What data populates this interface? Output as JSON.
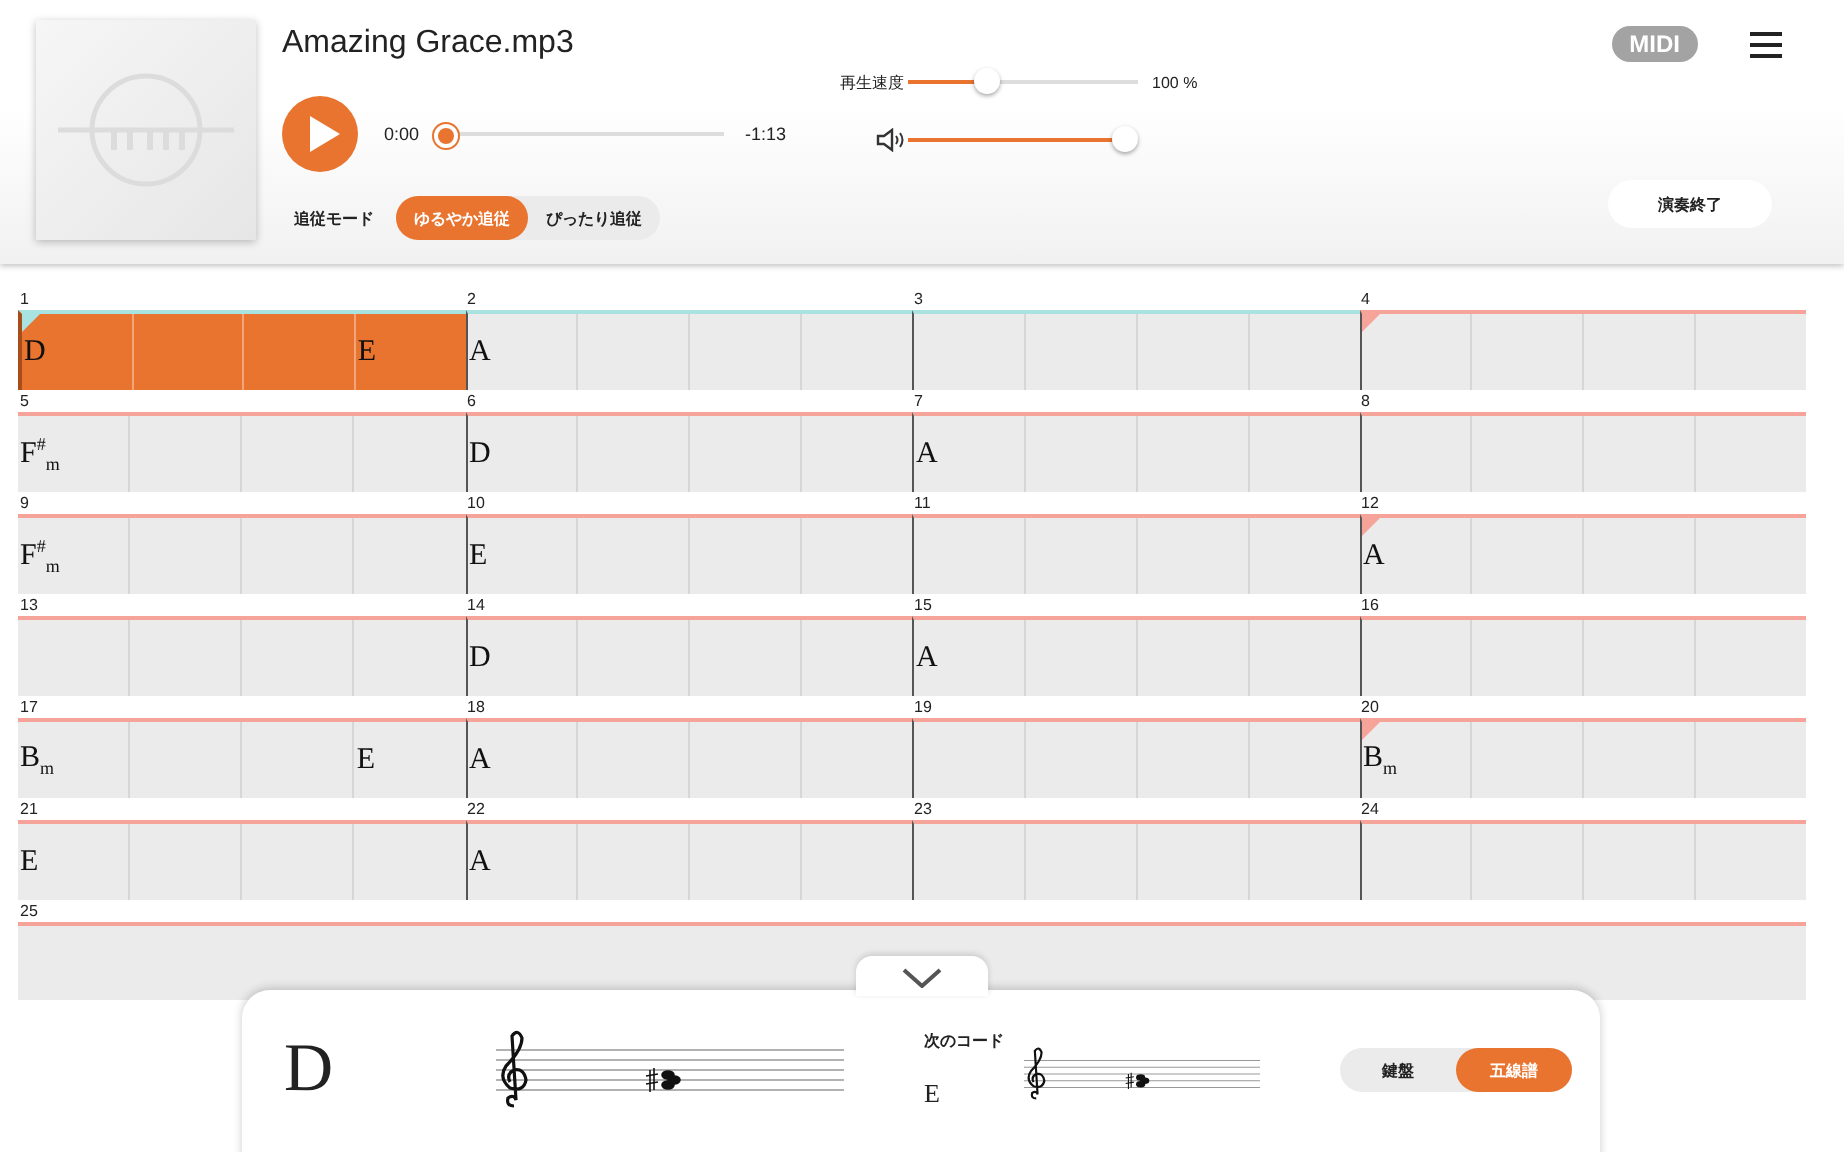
{
  "player": {
    "title": "Amazing Grace.mp3",
    "playing": false,
    "elapsed": "0:00",
    "remaining": "-1:13",
    "position": {
      "level": 0.0
    },
    "speed": {
      "label": "再生速度",
      "level": 0.35,
      "reading": "100 %"
    },
    "volume": {
      "level": 0.95
    }
  },
  "midi_badge": "MIDI",
  "follow_mode": {
    "label": "追従モード",
    "options": [
      {
        "label": "ゆるやか追従",
        "selected": true
      },
      {
        "label": "ぴったり追従",
        "selected": false
      }
    ]
  },
  "end_button": "演奏終了",
  "measures": [
    {
      "kind": "bar",
      "number": "1",
      "highlighted": true,
      "marker": true,
      "played": true,
      "beat_1": "D",
      "beat_4": "E"
    },
    {
      "kind": "bar",
      "number": "2",
      "highlighted": true,
      "marker": false,
      "played": false,
      "beat_1": "A"
    },
    {
      "kind": "bar",
      "number": "3",
      "highlighted": true,
      "marker": false,
      "played": false
    },
    {
      "kind": "bar",
      "number": "4",
      "highlighted": false,
      "marker": true,
      "played": false
    },
    {
      "kind": "bar",
      "number": "5",
      "highlighted": false,
      "marker": false,
      "played": false,
      "beat_1": "F$^{#}$$_{m}$"
    },
    {
      "kind": "bar",
      "number": "6",
      "highlighted": false,
      "marker": false,
      "played": false,
      "beat_1": "D"
    },
    {
      "kind": "bar",
      "number": "7",
      "highlighted": false,
      "marker": false,
      "played": false,
      "beat_1": "A"
    },
    {
      "kind": "bar",
      "number": "8",
      "highlighted": false,
      "marker": false,
      "played": false
    },
    {
      "kind": "bar",
      "number": "9",
      "highlighted": false,
      "marker": false,
      "played": false,
      "beat_1": "F$^{#}$$_{m}$"
    },
    {
      "kind": "bar",
      "number": "10",
      "highlighted": false,
      "marker": false,
      "played": false,
      "beat_1": "E"
    },
    {
      "kind": "bar",
      "number": "11",
      "highlighted": false,
      "marker": false,
      "played": false
    },
    {
      "kind": "bar",
      "number": "12",
      "highlighted": false,
      "marker": true,
      "played": false,
      "beat_1": "A"
    },
    {
      "kind": "bar",
      "number": "13",
      "highlighted": false,
      "marker": false,
      "played": false
    },
    {
      "kind": "bar",
      "number": "14",
      "highlighted": false,
      "marker": false,
      "played": false,
      "beat_1": "D"
    },
    {
      "kind": "bar",
      "number": "15",
      "highlighted": false,
      "marker": false,
      "played": false,
      "beat_1": "A"
    },
    {
      "kind": "bar",
      "number": "16",
      "highlighted": false,
      "marker": false,
      "played": false
    },
    {
      "kind": "bar",
      "number": "17",
      "highlighted": false,
      "marker": false,
      "played": false,
      "beat_1": "B$_{m}$",
      "beat_4": "E"
    },
    {
      "kind": "bar",
      "number": "18",
      "highlighted": false,
      "marker": false,
      "played": false,
      "beat_1": "A"
    },
    {
      "kind": "bar",
      "number": "19",
      "highlighted": false,
      "marker": false,
      "played": false
    },
    {
      "kind": "bar",
      "number": "20",
      "highlighted": false,
      "marker": true,
      "played": false,
      "beat_1": "B$_{m}$"
    },
    {
      "kind": "bar",
      "number": "21",
      "highlighted": false,
      "marker": false,
      "played": false,
      "beat_1": "E"
    },
    {
      "kind": "bar",
      "number": "22",
      "highlighted": false,
      "marker": false,
      "played": false,
      "beat_1": "A"
    },
    {
      "kind": "bar",
      "number": "23",
      "highlighted": false,
      "marker": false,
      "played": false
    },
    {
      "kind": "bar",
      "number": "24",
      "highlighted": false,
      "marker": false,
      "played": false
    },
    {
      "kind": "end",
      "number": "25",
      "highlighted": false,
      "marker": false,
      "played": false
    }
  ],
  "current_chord": {
    "name": "D"
  },
  "next_chord": {
    "label": "次のコード",
    "name": "E"
  },
  "view_toggle": [
    {
      "label": "鍵盤",
      "selected": false
    },
    {
      "label": "五線譜",
      "selected": true
    }
  ]
}
